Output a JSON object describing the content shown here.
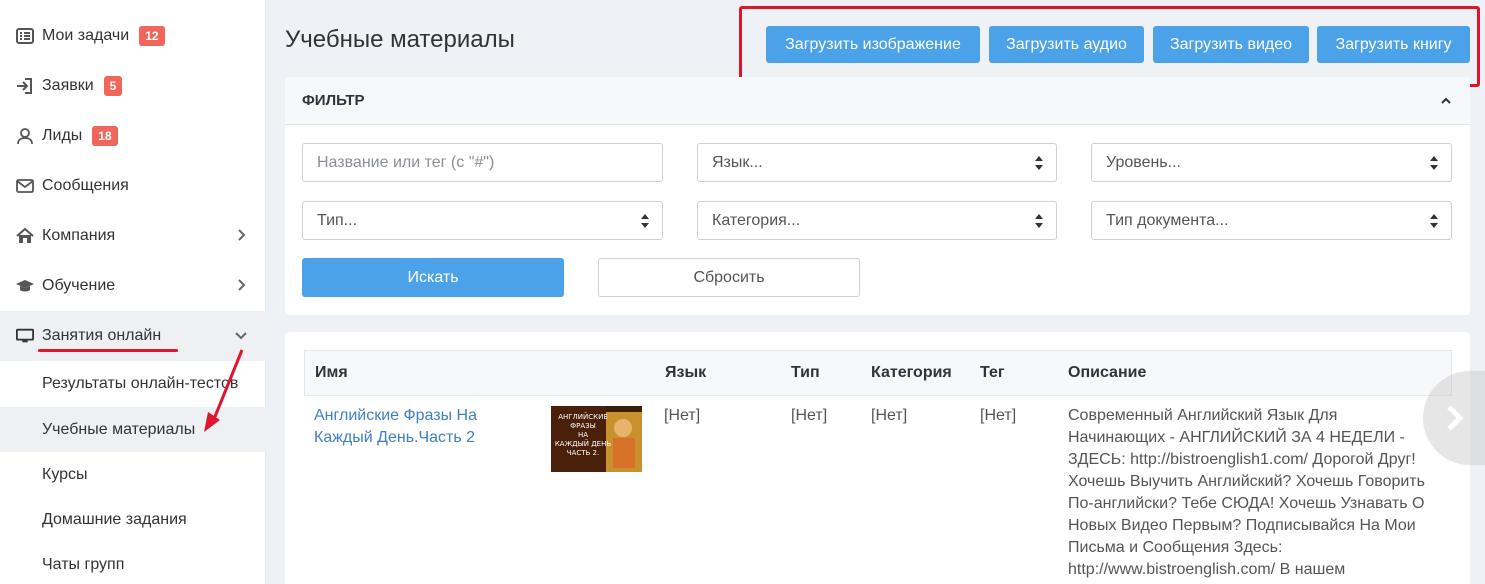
{
  "sidebar": {
    "items": [
      {
        "label": "Мои задачи",
        "badge": "12",
        "icon": "tasks-list-icon"
      },
      {
        "label": "Заявки",
        "badge": "5",
        "icon": "sign-in-icon"
      },
      {
        "label": "Лиды",
        "badge": "18",
        "icon": "user-icon"
      },
      {
        "label": "Сообщения",
        "icon": "envelope-icon"
      },
      {
        "label": "Компания",
        "icon": "home-icon"
      },
      {
        "label": "Обучение",
        "icon": "graduation-cap-icon"
      },
      {
        "label": "Занятия онлайн",
        "icon": "monitor-icon"
      }
    ],
    "sub_items": [
      {
        "label": "Результаты онлайн-тестов"
      },
      {
        "label": "Учебные материалы"
      },
      {
        "label": "Курсы"
      },
      {
        "label": "Домашние задания"
      },
      {
        "label": "Чаты групп"
      }
    ]
  },
  "header": {
    "title": "Учебные материалы",
    "upload_buttons": [
      "Загрузить изображение",
      "Загрузить аудио",
      "Загрузить видео",
      "Загрузить книгу"
    ]
  },
  "filter": {
    "title": "ФИЛЬТР",
    "search_placeholder": "Название или тег (с \"#\")",
    "language": "Язык...",
    "level": "Уровень...",
    "type": "Тип...",
    "category": "Категория...",
    "doc_type": "Тип документа...",
    "search_button": "Искать",
    "reset_button": "Сбросить"
  },
  "table": {
    "headers": [
      "Имя",
      "Язык",
      "Тип",
      "Категория",
      "Тег",
      "Описание"
    ],
    "rows": [
      {
        "name_line1": "Английские Фразы На",
        "name_line2": "Каждый День.Часть 2",
        "thumb_text": [
          "АНГЛИЙСКИЕ",
          "ФРАЗЫ",
          "НА",
          "КАЖДЫЙ ДЕНЬ",
          "ЧАСТЬ 2."
        ],
        "language": "[Нет]",
        "type": "[Нет]",
        "category": "[Нет]",
        "tag": "[Нет]",
        "description": [
          "Современный Английский Язык Для",
          "Начинающих - АНГЛИЙСКИЙ ЗА 4 НЕДЕЛИ -",
          "ЗДЕСЬ: http://bistroenglish1.com/ Дорогой Друг!",
          "Хочешь Выучить Английский? Хочешь Говорить",
          "По-английски? Тебе СЮДА! Хочешь Узнавать О",
          "Новых Видео Первым? Подписывайся На Мои",
          "Письма и Сообщения Здесь:",
          "http://www.bistroenglish.com/ В нашем"
        ]
      }
    ]
  },
  "colors": {
    "accent": "#4ba2e8",
    "badge": "#f0665a",
    "highlight": "#e0142a",
    "link": "#3f7fc4"
  }
}
